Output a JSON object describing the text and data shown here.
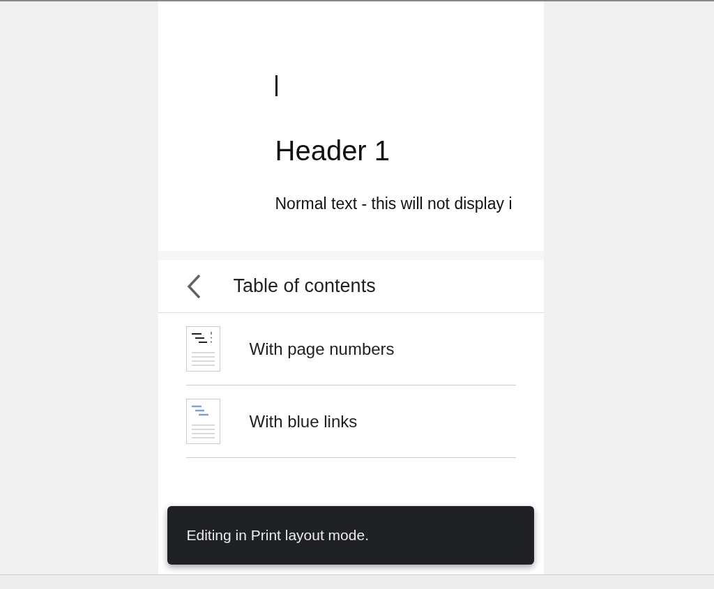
{
  "document": {
    "heading": "Header 1",
    "body": "Normal text - this will not display i"
  },
  "panel": {
    "title": "Table of contents",
    "options": [
      {
        "kind": "numbers",
        "label": "With page numbers"
      },
      {
        "kind": "links",
        "label": "With blue links"
      }
    ]
  },
  "toast": {
    "message": "Editing in Print layout mode."
  }
}
